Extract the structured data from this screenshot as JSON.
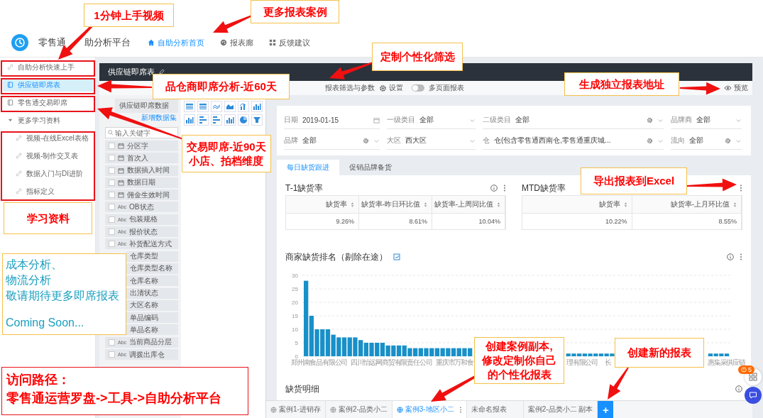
{
  "header": {
    "title_parts": [
      "零售通",
      "助分析平台"
    ],
    "nav": [
      {
        "label": "自助分析首页",
        "selected": true
      },
      {
        "label": "报表廊",
        "selected": false
      },
      {
        "label": "反馈建议",
        "selected": false
      }
    ]
  },
  "sidebar": {
    "items": [
      {
        "label": "自助分析快速上手",
        "kind": "link",
        "selected": false
      },
      {
        "label": "供应链即席表",
        "kind": "report",
        "selected": true
      },
      {
        "label": "零售通交易即席",
        "kind": "report",
        "selected": false
      },
      {
        "label": "更多学习资料",
        "kind": "group",
        "selected": false,
        "expanded": true,
        "children": [
          {
            "label": "视频-在线Excel表格",
            "kind": "link",
            "selected": false
          },
          {
            "label": "视频-制作交叉表",
            "kind": "link",
            "selected": false
          },
          {
            "label": "数据入门与DI进阶",
            "kind": "link",
            "selected": false
          },
          {
            "label": "指标定义",
            "kind": "link",
            "selected": false
          }
        ]
      }
    ]
  },
  "editor": {
    "title": "供应链即席表",
    "toolbar": {
      "filter_label": "报表筛选与参数",
      "settings_label": "设置",
      "multipage": {
        "label": "多页面报表",
        "on": false
      },
      "preview_label": "预览"
    }
  },
  "data_panel": {
    "dataset": "供应链即席数据",
    "add_dataset": "新增数据集",
    "search": {
      "placeholder": "输入关键字"
    },
    "fields": [
      {
        "kind": "date",
        "name": "分区字",
        "checked": false
      },
      {
        "kind": "date",
        "name": "首次入",
        "checked": false
      },
      {
        "kind": "date",
        "name": "数据插入时间",
        "checked": false
      },
      {
        "kind": "date",
        "name": "数据日期",
        "checked": false
      },
      {
        "kind": "date",
        "name": "佣金生效时间",
        "checked": false
      },
      {
        "kind": "text",
        "type": "Abc",
        "name": "OB状态",
        "checked": false
      },
      {
        "kind": "text",
        "type": "Abc",
        "name": "包装规格",
        "checked": false
      },
      {
        "kind": "text",
        "type": "Abc",
        "name": "报价状态",
        "checked": false
      },
      {
        "kind": "text",
        "type": "Abc",
        "name": "补货配送方式",
        "checked": false
      },
      {
        "name": "仓库类型"
      },
      {
        "name": "仓库类型名称"
      },
      {
        "name": "仓库名称"
      },
      {
        "name": "出清状态"
      },
      {
        "name": "大区名称"
      },
      {
        "name": "单品编码"
      },
      {
        "name": "单品名称"
      },
      {
        "kind": "text",
        "type": "Abc",
        "name": "当前商品分层",
        "checked": false
      },
      {
        "kind": "text",
        "type": "Abc",
        "name": "调拨出库仓",
        "checked": false
      }
    ]
  },
  "filters": [
    {
      "label": "日期",
      "value": "2019-01-15",
      "kind": "date",
      "settings": false
    },
    {
      "label": "一级类目",
      "value": "全部",
      "kind": "select",
      "settings": false
    },
    {
      "label": "二级类目",
      "value": "全部",
      "kind": "select",
      "settings": true
    },
    {
      "label": "品牌商",
      "value": "全部",
      "kind": "select",
      "settings": false
    },
    {
      "label": "品牌",
      "value": "全部",
      "kind": "select",
      "settings": true
    },
    {
      "label": "大区",
      "value": "西大区",
      "kind": "select",
      "settings": false
    },
    {
      "label": "仓",
      "value": "仓(包含零售通西南仓,零售通重庆城...",
      "kind": "select",
      "settings": true
    },
    {
      "label": "流向",
      "value": "全部",
      "kind": "select",
      "settings": true
    }
  ],
  "report": {
    "tabs": [
      {
        "label": "每日缺货跟进",
        "selected": true
      },
      {
        "label": "促销品牌备货",
        "selected": false
      }
    ],
    "metrics": [
      {
        "title": "T-1缺货率",
        "info": true,
        "columns": [
          "缺货率",
          "缺货率-昨日环比值",
          "缺货率-上周同比值"
        ],
        "values": [
          "9.26%",
          "8.61%",
          "10.04%"
        ]
      },
      {
        "title": "MTD缺货率",
        "info": false,
        "columns": [
          "缺货率",
          "缺货率-上月环比值"
        ],
        "values": [
          "10.22%",
          "8.55%"
        ]
      }
    ],
    "chart": {
      "title": "商家缺货排名（剔除在途）",
      "axis_labels": [
        "郑州南食品有限公司",
        "四川怡远网商贸有限责任公司",
        "重庆市万和食",
        "理有限公司",
        "长",
        "惠集采供应链"
      ],
      "chart_data": {
        "type": "bar",
        "ylim": [
          0,
          30
        ],
        "yticks": [
          0,
          5,
          10,
          15,
          20,
          25,
          30
        ],
        "grid": true,
        "values": [
          28,
          15,
          10,
          10,
          10,
          8,
          7,
          7,
          7,
          7,
          6,
          5,
          5,
          5,
          5,
          4,
          4,
          4,
          4,
          3,
          3,
          3,
          3,
          3,
          3,
          3,
          3,
          3,
          3,
          3,
          3,
          null,
          null,
          null,
          null,
          null,
          null,
          null,
          null,
          null,
          null,
          null,
          null,
          null,
          null,
          null,
          null,
          null,
          1,
          1,
          1,
          1,
          1,
          1,
          1,
          1,
          1,
          null,
          null,
          null,
          null,
          null,
          null,
          null,
          null,
          null,
          null,
          null,
          null,
          null,
          null,
          null,
          null,
          null,
          1,
          1,
          1,
          1
        ]
      }
    },
    "detail": {
      "title": "缺货明细",
      "info": true
    }
  },
  "bottom_tabs": {
    "tabs": [
      {
        "label": "案例1-进销存",
        "shared": true,
        "selected": false
      },
      {
        "label": "案例2-品类小二",
        "shared": true,
        "selected": false
      },
      {
        "label": "案例3-地区小二",
        "shared": true,
        "selected": true
      },
      {
        "label": "未命名报表",
        "shared": false,
        "selected": false
      },
      {
        "label": "案例2-品类小二 副本",
        "shared": false,
        "selected": false
      }
    ],
    "add": "+"
  },
  "notification_badge": "5",
  "callouts": [
    {
      "kind": "label",
      "color": "#ff0000",
      "lines": [
        "1分钟上手视频"
      ]
    },
    {
      "kind": "label",
      "color": "#ff0000",
      "lines": [
        "更多报表案例"
      ]
    },
    {
      "kind": "label",
      "color": "#ff0000",
      "lines": [
        "定制个性化筛选"
      ]
    },
    {
      "kind": "label",
      "color": "#ff0000",
      "lines": [
        "品仓商即席分析-近60天"
      ]
    },
    {
      "kind": "label",
      "color": "#ff0000",
      "lines": [
        "生成独立报表地址"
      ]
    },
    {
      "kind": "label",
      "color": "#ff0000",
      "lines": [
        "交易即席-近90天",
        "小店、拍档维度"
      ]
    },
    {
      "kind": "label",
      "color": "#ff0000",
      "lines": [
        "导出报表到Excel"
      ]
    },
    {
      "kind": "label",
      "color": "#ff0000",
      "lines": [
        "学习资料"
      ]
    },
    {
      "kind": "note",
      "color": "#1a9fc0",
      "lines": [
        "成本分析、",
        "物流分析",
        "敬请期待更多即席报表",
        "Coming Soon..."
      ]
    },
    {
      "kind": "label",
      "color": "#ff0000",
      "lines": [
        "创建案例副本,",
        "修改定制你自己",
        "的个性化报表"
      ]
    },
    {
      "kind": "label",
      "color": "#ff0000",
      "lines": [
        "创建新的报表"
      ]
    },
    {
      "kind": "path",
      "color": "#ff0000",
      "lines": [
        "访问路径：",
        "零售通运营罗盘->工具->自助分析平台"
      ]
    }
  ]
}
